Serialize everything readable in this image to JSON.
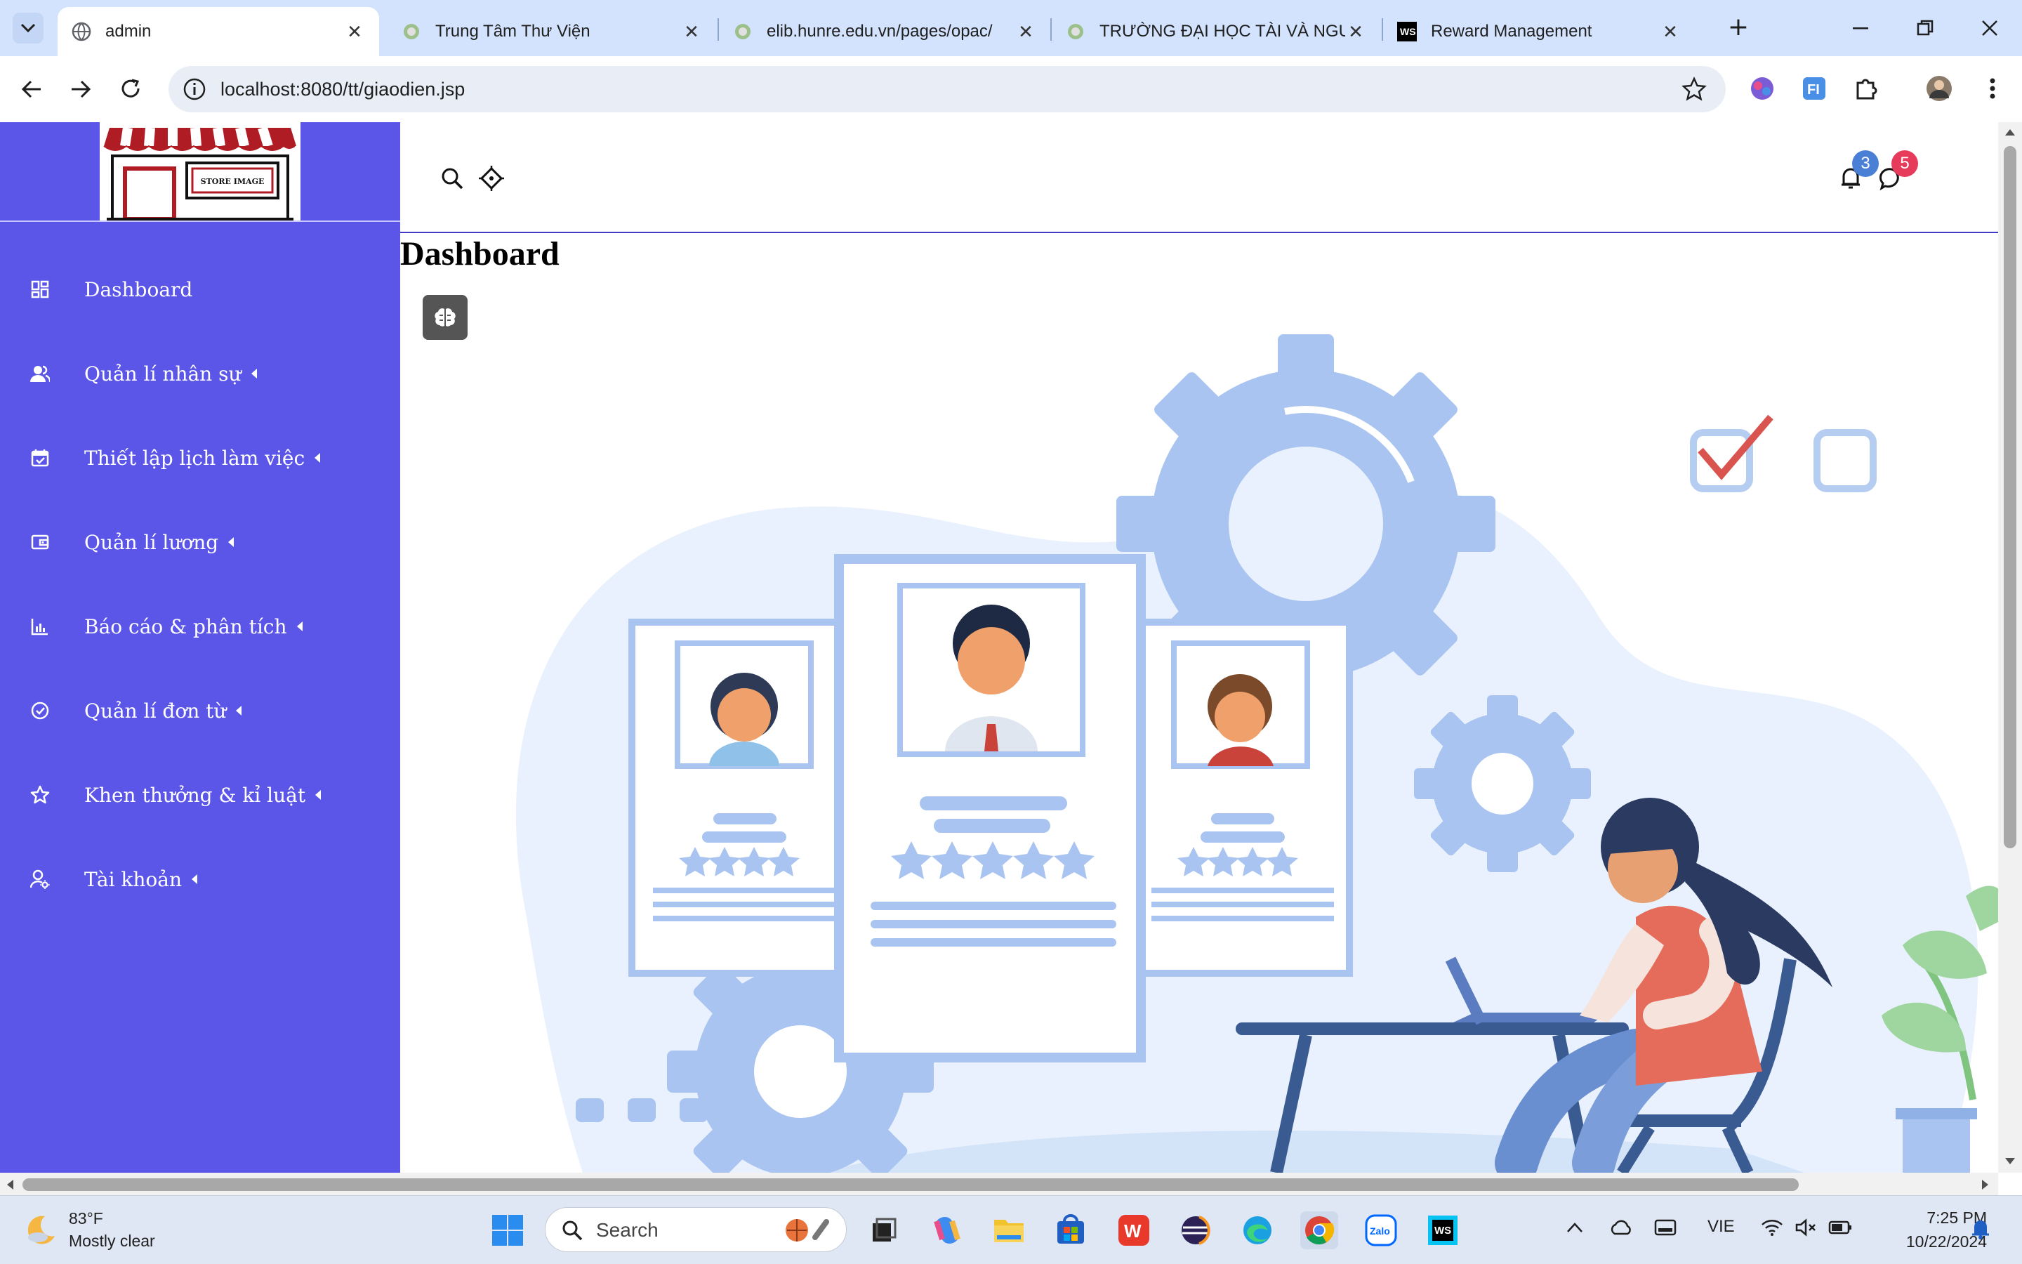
{
  "browser": {
    "tabs": [
      {
        "title": "admin",
        "active": true,
        "favicon": "globe-icon"
      },
      {
        "title": "Trung Tâm Thư Viện",
        "active": false,
        "favicon": "site-icon"
      },
      {
        "title": "elib.hunre.edu.vn/pages/opac/",
        "active": false,
        "favicon": "site-icon"
      },
      {
        "title": "TRƯỜNG ĐẠI HỌC TÀI VÀ NGU",
        "active": false,
        "favicon": "site-icon"
      },
      {
        "title": "Reward Management",
        "active": false,
        "favicon": "webstorm-icon"
      }
    ],
    "url": "localhost:8080/tt/giaodien.jsp"
  },
  "sidebar": {
    "logo_text": "STORE IMAGE",
    "items": [
      {
        "label": "Dashboard",
        "icon": "dashboard-icon",
        "has_caret": false
      },
      {
        "label": "Quản lí nhân sự",
        "icon": "users-icon",
        "has_caret": true
      },
      {
        "label": "Thiết lập lịch làm việc",
        "icon": "calendar-icon",
        "has_caret": true
      },
      {
        "label": "Quản lí lương",
        "icon": "wallet-icon",
        "has_caret": true
      },
      {
        "label": "Báo cáo & phân tích",
        "icon": "bar-chart-icon",
        "has_caret": true
      },
      {
        "label": "Quản lí đơn từ",
        "icon": "check-circle-icon",
        "has_caret": true
      },
      {
        "label": "Khen thưởng & kỉ luật",
        "icon": "star-icon",
        "has_caret": true
      },
      {
        "label": "Tài khoản",
        "icon": "user-settings-icon",
        "has_caret": true
      }
    ]
  },
  "header": {
    "notifications_count": "3",
    "messages_count": "5"
  },
  "main": {
    "title": "Dashboard"
  },
  "colors": {
    "sidebar_bg": "#5b55e8",
    "accent": "#4338ca",
    "badge_blue": "#4a7fd6",
    "badge_red": "#e63b5b"
  },
  "taskbar": {
    "weather_temp": "83°F",
    "weather_desc": "Mostly clear",
    "search_placeholder": "Search",
    "language": "VIE",
    "time": "7:25 PM",
    "date": "10/22/2024"
  }
}
